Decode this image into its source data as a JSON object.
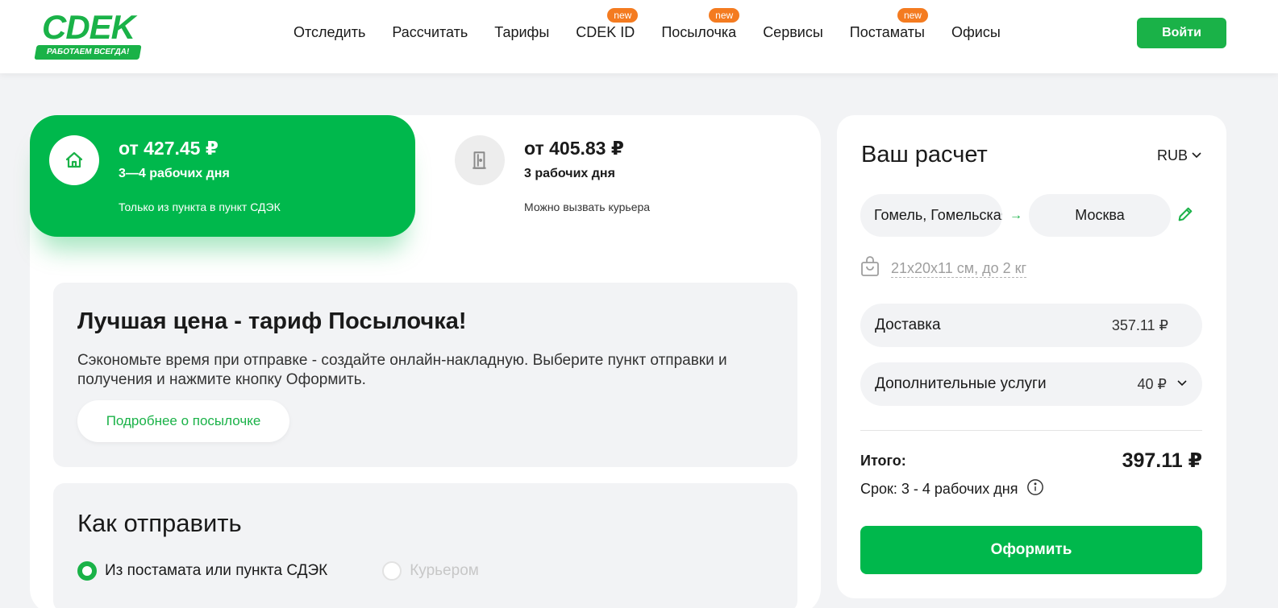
{
  "header": {
    "logo_text": "CDEK",
    "logo_tagline": "РАБОТАЕМ ВСЕГДА!",
    "nav": [
      {
        "label": "Отследить",
        "badge": ""
      },
      {
        "label": "Рассчитать",
        "badge": ""
      },
      {
        "label": "Тарифы",
        "badge": ""
      },
      {
        "label": "CDEK ID",
        "badge": "new"
      },
      {
        "label": "Посылочка",
        "badge": "new"
      },
      {
        "label": "Сервисы",
        "badge": ""
      },
      {
        "label": "Постаматы",
        "badge": "new"
      },
      {
        "label": "Офисы",
        "badge": ""
      }
    ],
    "login_label": "Войти"
  },
  "tariffs": [
    {
      "price": "от 427.45 ₽",
      "days": "3—4 рабочих дня",
      "note": "Только из пункта в пункт СДЭК",
      "icon": "home-icon",
      "selected": true
    },
    {
      "price": "от 405.83 ₽",
      "days": "3 рабочих дня",
      "note": "Можно вызвать курьера",
      "icon": "door-icon",
      "selected": false
    }
  ],
  "promo": {
    "title": "Лучшая цена - тариф Посылочка!",
    "text": "Сэкономьте время при отправке - создайте онлайн-накладную. Выберите пункт отправки и получения и нажмите кнопку Оформить.",
    "button": "Подробнее о посылочке"
  },
  "how_to_send": {
    "title": "Как отправить",
    "options": [
      {
        "label": "Из постамата или пункта СДЭК",
        "selected": true
      },
      {
        "label": "Курьером",
        "selected": false
      }
    ]
  },
  "calc": {
    "title": "Ваш расчет",
    "currency": "RUB",
    "from": "Гомель, Гомельская",
    "to": "Москва",
    "parcel": "21x20x11 см, до 2 кг",
    "delivery_label": "Доставка",
    "delivery_value": "357.11 ₽",
    "extra_label": "Дополнительные услуги",
    "extra_value": "40 ₽",
    "total_label": "Итого:",
    "total_value": "397.11 ₽",
    "term": "Срок: 3 - 4 рабочих дня",
    "submit": "Оформить"
  },
  "colors": {
    "brand": "#1ab248",
    "accent_badge": "#f47b20"
  }
}
